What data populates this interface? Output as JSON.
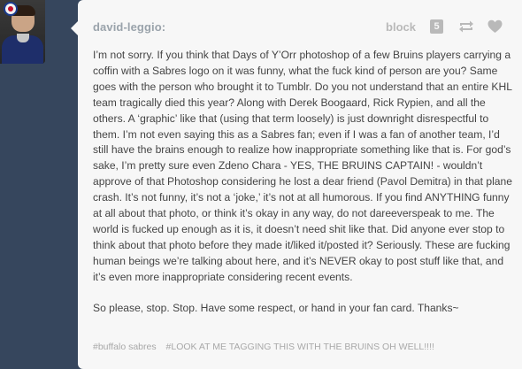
{
  "post": {
    "username": "david-leggio:",
    "block_label": "block",
    "note_count": "5",
    "body_paragraphs": [
      "I’m not sorry. If you think that Days of Y’Orr photoshop of a few Bruins players carrying a coffin with a Sabres logo on it was funny, what the fuck kind of person are you? Same goes with the person who brought it to Tumblr. Do you not understand that an entire KHL team tragically died this year? Along with Derek Boogaard, Rick Rypien, and all the others. A ‘graphic’ like that (using that term loosely) is just downright disrespectful to them. I’m not even saying this as a Sabres fan; even if I was a fan of another team, I’d still have the brains enough to realize how inappropriate something like that is. For god’s sake, I’m pretty sure even Zdeno Chara - YES, THE BRUINS CAPTAIN! - wouldn’t approve of that Photoshop considering he lost a dear friend (Pavol Demitra) in that plane crash. It’s not funny, it’s not a ‘joke,’ it’s not at all humorous. If you find ANYTHING funny at all about that photo, or think it’s okay in any way, do not dareeverspeak to me. The world is fucked up enough as it is, it doesn’t need shit like that. Did anyone ever stop to think about that photo before they made it/liked it/posted it? Seriously. These are fucking human beings we’re talking about here, and it’s NEVER okay to post stuff like that, and it’s even more inappropriate considering recent events.",
      "So please, stop. Stop. Have some respect, or hand in your fan card. Thanks~"
    ],
    "tags": [
      "#buffalo sabres",
      "#LOOK AT ME TAGGING THIS WITH THE BRUINS OH WELL!!!!"
    ]
  },
  "icons": {
    "avatar": "user-avatar-hockey-player",
    "reblog": "reblog-icon",
    "like": "heart-icon"
  },
  "colors": {
    "dashboard_background": "#36465d",
    "card_background": "#f7f7f7",
    "username": "#9aa3ab",
    "body_text": "#444444",
    "control_icons": "#b9b9b9",
    "tags": "#a8a8a8"
  }
}
